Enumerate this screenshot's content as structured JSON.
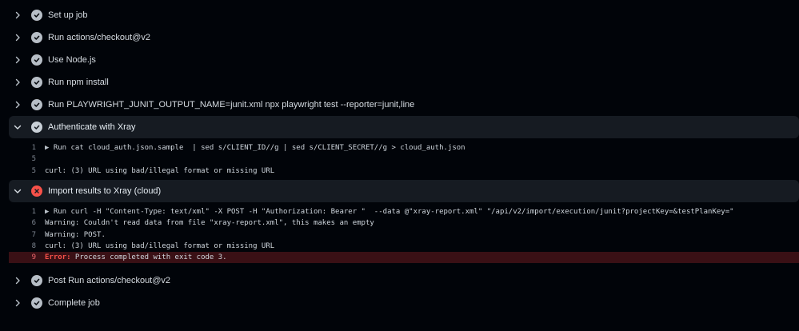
{
  "colors": {
    "success": "#8b949e",
    "failure": "#f85149",
    "background": "#010409",
    "step_header_bg": "#161b22",
    "error_line_bg": "#3a1015"
  },
  "steps": [
    {
      "label": "Set up job",
      "status": "success",
      "chevron": "chevron-right-icon"
    },
    {
      "label": "Run actions/checkout@v2",
      "status": "success",
      "chevron": "chevron-right-icon"
    },
    {
      "label": "Use Node.js",
      "status": "success",
      "chevron": "chevron-right-icon"
    },
    {
      "label": "Run npm install",
      "status": "success",
      "chevron": "chevron-right-icon"
    },
    {
      "label": "Run PLAYWRIGHT_JUNIT_OUTPUT_NAME=junit.xml npx playwright test --reporter=junit,line",
      "status": "success",
      "chevron": "chevron-right-icon"
    },
    {
      "label": "Authenticate with Xray",
      "status": "success",
      "chevron": "chevron-down-icon",
      "lines": [
        {
          "num": "1",
          "text": "Run cat cloud_auth.json.sample  | sed s/CLIENT_ID//g | sed s/CLIENT_SECRET//g > cloud_auth.json",
          "collapsible": true
        },
        {
          "num": "5",
          "text": ""
        },
        {
          "num": "5",
          "text": "curl: (3) URL using bad/illegal format or missing URL"
        }
      ]
    },
    {
      "label": "Import results to Xray (cloud)",
      "status": "failure",
      "chevron": "chevron-down-icon",
      "lines": [
        {
          "num": "1",
          "text": "Run curl -H \"Content-Type: text/xml\" -X POST -H \"Authorization: Bearer \"  --data @\"xray-report.xml\" \"/api/v2/import/execution/junit?projectKey=&testPlanKey=\"",
          "collapsible": true
        },
        {
          "num": "6",
          "text": "Warning: Couldn't read data from file \"xray-report.xml\", this makes an empty"
        },
        {
          "num": "7",
          "text": "Warning: POST."
        },
        {
          "num": "8",
          "text": "curl: (3) URL using bad/illegal format or missing URL"
        },
        {
          "num": "9",
          "error_label": "Error:",
          "text": " Process completed with exit code 3.",
          "error": true
        }
      ]
    },
    {
      "label": "Post Run actions/checkout@v2",
      "status": "success",
      "chevron": "chevron-right-icon"
    },
    {
      "label": "Complete job",
      "status": "success",
      "chevron": "chevron-right-icon"
    }
  ]
}
